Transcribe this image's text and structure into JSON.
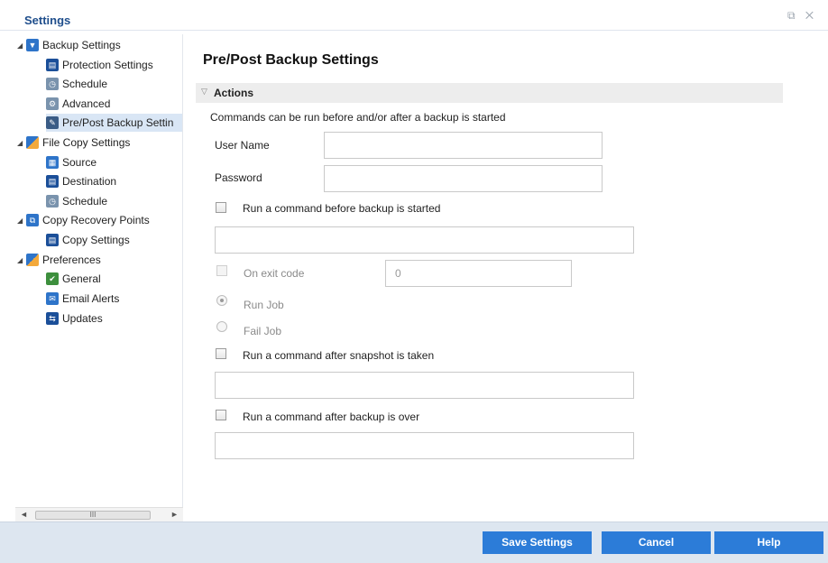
{
  "window": {
    "title": "Settings",
    "controls": "⧉ ✕"
  },
  "sidebar": {
    "items": [
      {
        "label": "Backup Settings",
        "level": 0,
        "icon": "backup-settings-icon"
      },
      {
        "label": "Protection Settings",
        "level": 1,
        "icon": "protection-settings-icon"
      },
      {
        "label": "Schedule",
        "level": 1,
        "icon": "schedule-icon"
      },
      {
        "label": "Advanced",
        "level": 1,
        "icon": "advanced-icon"
      },
      {
        "label": "Pre/Post Backup Settin",
        "level": 1,
        "icon": "wrench-icon",
        "selected": true
      },
      {
        "label": "File Copy Settings",
        "level": 0,
        "icon": "file-copy-settings-icon"
      },
      {
        "label": "Source",
        "level": 1,
        "icon": "source-icon"
      },
      {
        "label": "Destination",
        "level": 1,
        "icon": "destination-icon"
      },
      {
        "label": "Schedule",
        "level": 1,
        "icon": "schedule-icon"
      },
      {
        "label": "Copy Recovery Points",
        "level": 0,
        "icon": "copy-recovery-points-icon"
      },
      {
        "label": "Copy Settings",
        "level": 1,
        "icon": "copy-settings-icon"
      },
      {
        "label": "Preferences",
        "level": 0,
        "icon": "preferences-icon"
      },
      {
        "label": "General",
        "level": 1,
        "icon": "general-icon"
      },
      {
        "label": "Email Alerts",
        "level": 1,
        "icon": "email-alerts-icon"
      },
      {
        "label": "Updates",
        "level": 1,
        "icon": "updates-icon"
      }
    ],
    "scrollbar": {
      "left_arrow": "◄",
      "right_arrow": "►",
      "grip": "III"
    }
  },
  "main": {
    "heading": "Pre/Post Backup Settings",
    "section_title": "Actions",
    "description": "Commands can be run before and/or after a backup is started",
    "user_name_label": "User Name",
    "user_name_value": "",
    "password_label": "Password",
    "password_value": "",
    "before_backup_label": "Run a command before backup is started",
    "before_backup_command": "",
    "on_exit_code_label": "On exit code",
    "exit_code_value": "0",
    "run_job_label": "Run Job",
    "fail_job_label": "Fail Job",
    "after_snapshot_label": "Run a command after snapshot is taken",
    "after_snapshot_command": "",
    "after_backup_label": "Run a command after backup is over",
    "after_backup_command": ""
  },
  "footer": {
    "save_label": "Save Settings",
    "cancel_label": "Cancel",
    "help_label": "Help"
  },
  "colors": {
    "accent": "#2c7cd8",
    "title": "#1f4e8c",
    "footer_bg": "#dde6f0",
    "selection_bg": "#d9e6f5"
  }
}
